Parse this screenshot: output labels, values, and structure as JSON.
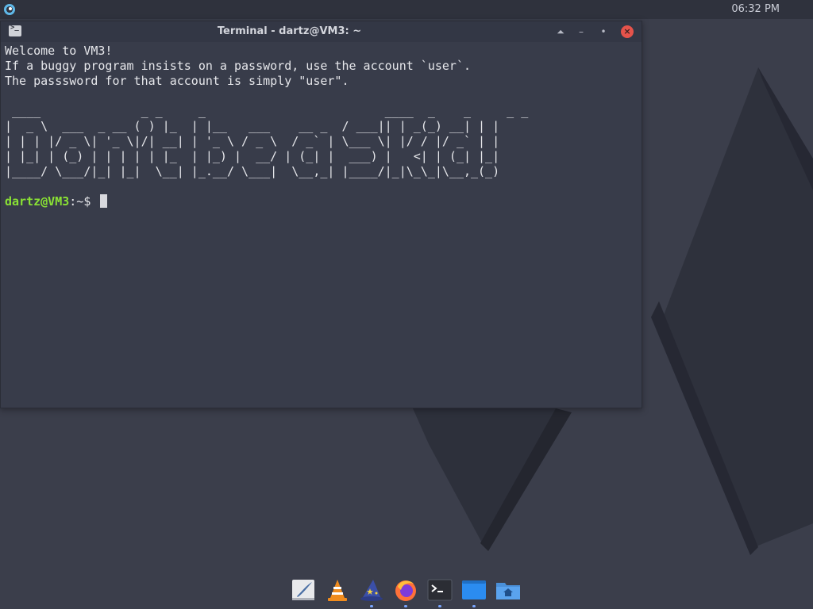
{
  "top_panel": {
    "clock": "06:32 PM",
    "menu_icon": "distro-logo-icon"
  },
  "window": {
    "title": "Terminal - dartz@VM3: ~",
    "app_icon": "terminal-icon",
    "buttons": [
      "shade-icon",
      "minimize-icon",
      "maximize-icon",
      "close-icon"
    ]
  },
  "terminal": {
    "lines": [
      "Welcome to VM3!",
      "If a buggy program insists on a password, use the account `user`.",
      "The passsword for that account is simply \"user\"."
    ],
    "ascii_art": " ____              _ _     _                         ____  _    _     _ _ \n|  _ \\  ___  _ __ ( ) |_  | |__   ___    __ _  / ___|| | _(_) __| | |\n| | | |/ _ \\| '_ \\|/| __| | '_ \\ / _ \\  / _` | \\___ \\| |/ / |/ _` | |\n| |_| | (_) | | | | | |_  | |_) |  __/ | (_| |  ___) |   <| | (_| |_|\n|____/ \\___/|_| |_|  \\__| |_.__/ \\___|  \\__,_| |____/|_|\\_\\_|\\__,_(_)",
    "prompt_user": "dartz@VM3",
    "prompt_path": ":~$ "
  },
  "dock": {
    "items": [
      {
        "name": "text-editor-icon",
        "label": "Text Editor"
      },
      {
        "name": "vlc-icon",
        "label": "VLC"
      },
      {
        "name": "wizard-hat-icon",
        "label": "Wizard"
      },
      {
        "name": "firefox-icon",
        "label": "Firefox"
      },
      {
        "name": "terminal-icon",
        "label": "Terminal"
      },
      {
        "name": "blue-window-icon",
        "label": "Window"
      },
      {
        "name": "home-folder-icon",
        "label": "Home"
      }
    ]
  },
  "colors": {
    "desktop": "#3b3e4b",
    "terminal_bg": "#383c4a",
    "prompt_green": "#8ae234",
    "close_red": "#e5534b"
  }
}
